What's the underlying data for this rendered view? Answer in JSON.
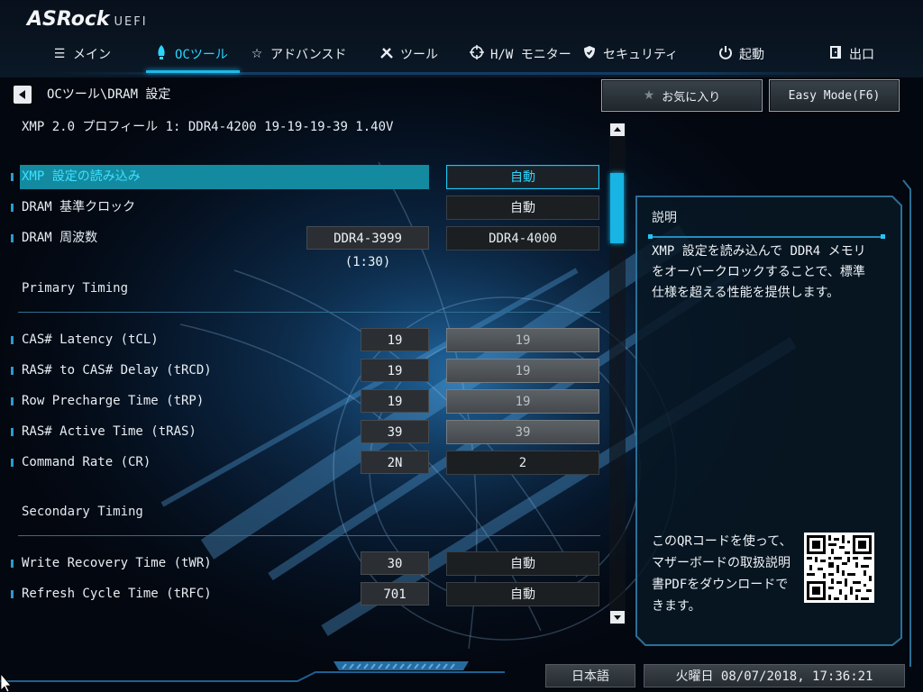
{
  "brand": {
    "name": "ASRock",
    "sub": "UEFI"
  },
  "nav": {
    "tabs": [
      {
        "label": "メイン",
        "icon": "list-icon",
        "active": false
      },
      {
        "label": "OCツール",
        "icon": "rocket-icon",
        "active": true
      },
      {
        "label": "アドバンスド",
        "icon": "star-icon",
        "active": false
      },
      {
        "label": "ツール",
        "icon": "tools-icon",
        "active": false
      },
      {
        "label": "H/W モニター",
        "icon": "crosshair-icon",
        "active": false
      },
      {
        "label": "セキュリティ",
        "icon": "shield-icon",
        "active": false
      },
      {
        "label": "起動",
        "icon": "power-icon",
        "active": false
      },
      {
        "label": "出口",
        "icon": "exit-door-icon",
        "active": false
      }
    ]
  },
  "breadcrumb": "OCツール\\DRAM 設定",
  "buttons": {
    "favorites": "お気に入り",
    "easy_mode": "Easy Mode(F6)"
  },
  "profile_info": "XMP 2.0 プロフィール 1: DDR4-4200 19-19-19-39 1.40V",
  "settings": {
    "load_xmp": {
      "label": "XMP 設定の読み込み",
      "value": "自動"
    },
    "dram_ref_clock": {
      "label": "DRAM 基準クロック",
      "value": "自動"
    },
    "dram_frequency": {
      "label": "DRAM 周波数",
      "current": "DDR4-3999 (1:30)",
      "value": "DDR4-4000"
    }
  },
  "sections": {
    "primary": "Primary Timing",
    "secondary": "Secondary Timing"
  },
  "primary_timings": [
    {
      "label": "CAS# Latency (tCL)",
      "current": "19",
      "value": "19"
    },
    {
      "label": "RAS# to CAS# Delay (tRCD)",
      "current": "19",
      "value": "19"
    },
    {
      "label": "Row Precharge Time (tRP)",
      "current": "19",
      "value": "19"
    },
    {
      "label": "RAS# Active Time (tRAS)",
      "current": "39",
      "value": "39"
    },
    {
      "label": "Command Rate (CR)",
      "current": "2N",
      "value": "2"
    }
  ],
  "secondary_timings": [
    {
      "label": "Write Recovery Time (tWR)",
      "current": "30",
      "value": "自動"
    },
    {
      "label": "Refresh Cycle Time (tRFC)",
      "current": "701",
      "value": "自動"
    }
  ],
  "description": {
    "title": "説明",
    "text": "XMP 設定を読み込んで DDR4 メモリをオーバークロックすることで、標準仕様を超える性能を提供します。",
    "qr_text": "このQRコードを使って、マザーボードの取扱説明書PDFをダウンロードできます。"
  },
  "footer": {
    "language": "日本語",
    "datetime": "火曜日 08/07/2018, 17:36:21"
  },
  "colors": {
    "accent": "#2ad6ff",
    "selection": "#138aa0",
    "panel_border": "#1f8fbe"
  }
}
